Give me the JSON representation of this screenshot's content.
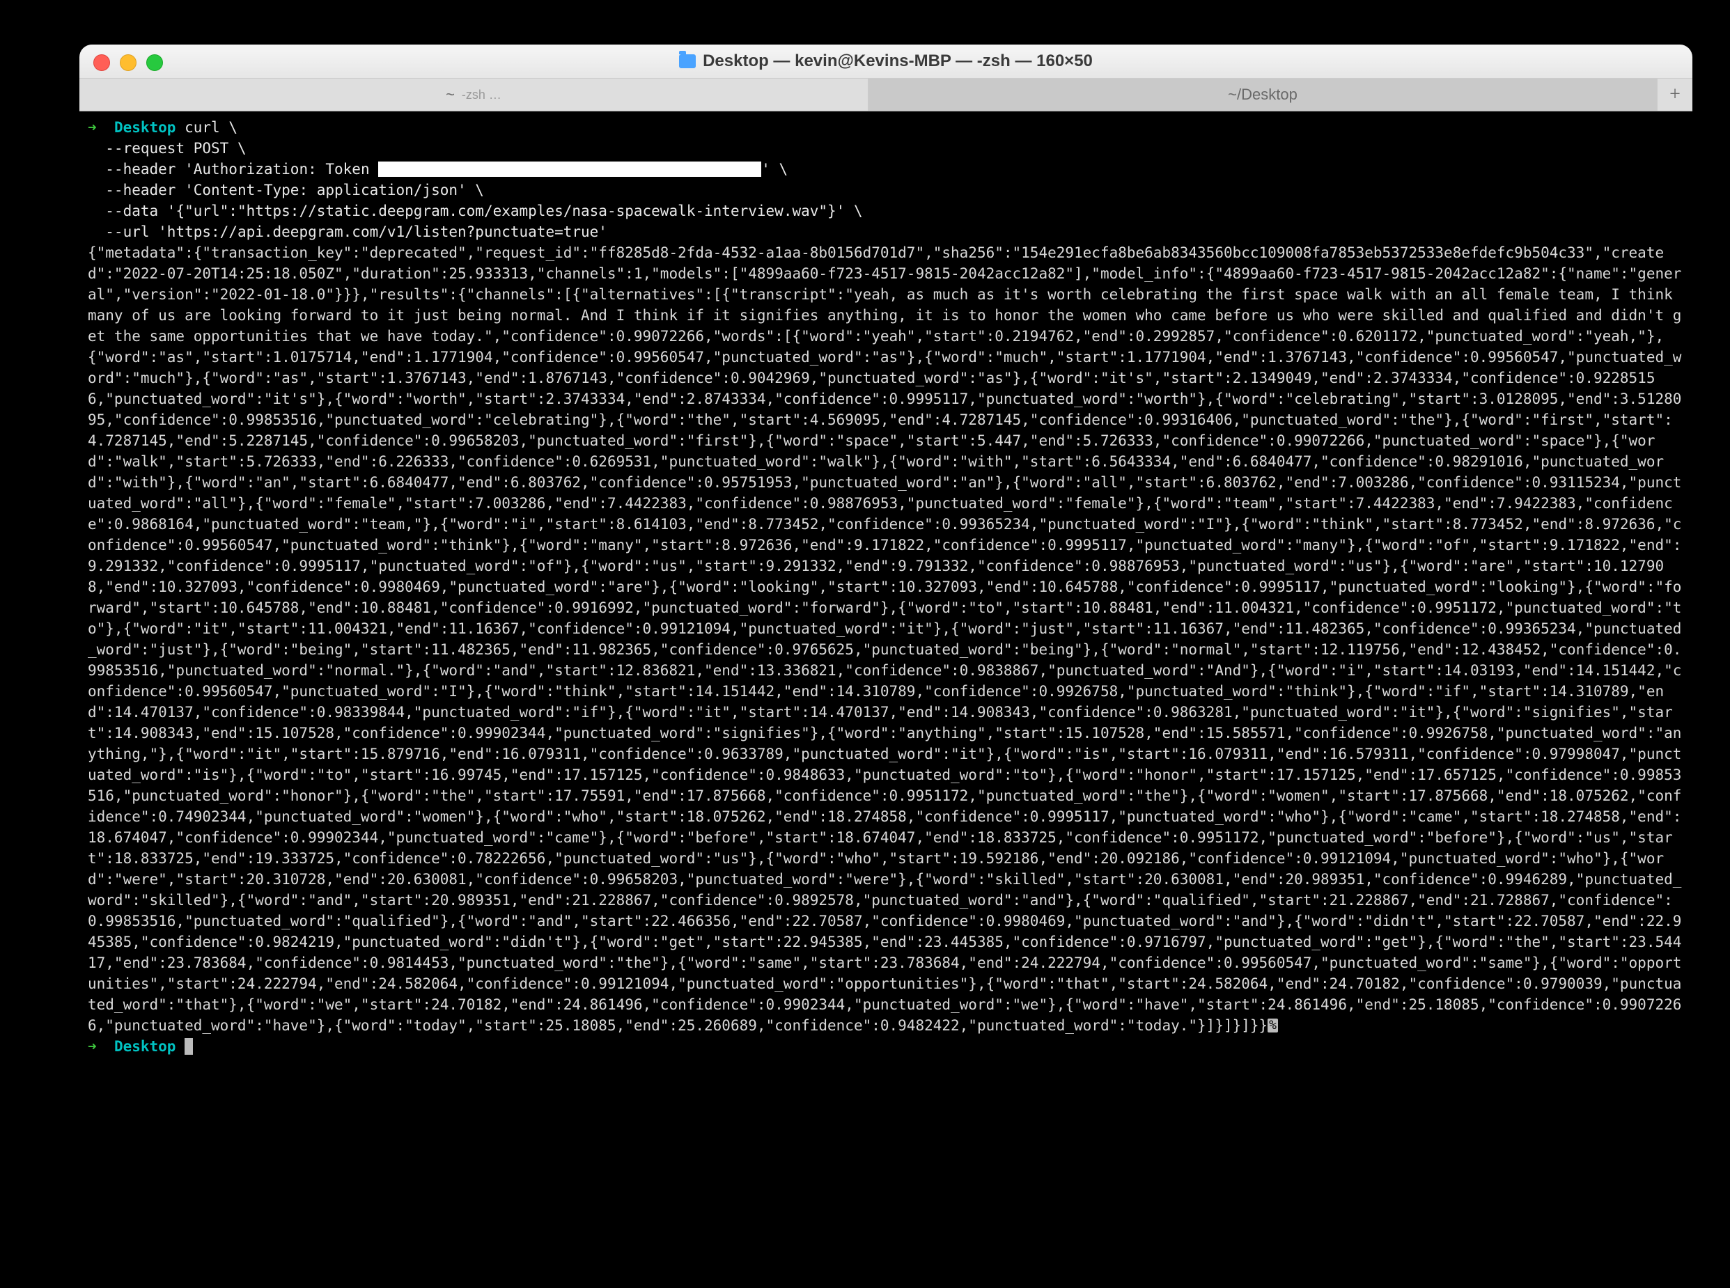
{
  "window": {
    "title": "Desktop — kevin@Kevins-MBP — -zsh — 160×50"
  },
  "tabs": {
    "left_main": "~",
    "left_sub": "-zsh …",
    "right": "~/Desktop",
    "newtab": "+"
  },
  "prompt": {
    "arrow": "➜",
    "dir": "Desktop"
  },
  "cmd": {
    "l1": "curl \\",
    "l2": "  --request POST \\",
    "l3a": "  --header 'Authorization: Token ",
    "l3b": "' \\",
    "l4": "  --header 'Content-Type: application/json' \\",
    "l5": "  --data '{\"url\":\"https://static.deepgram.com/examples/nasa-spacewalk-interview.wav\"}' \\",
    "l6": "  --url 'https://api.deepgram.com/v1/listen?punctuate=true'"
  },
  "output": "{\"metadata\":{\"transaction_key\":\"deprecated\",\"request_id\":\"ff8285d8-2fda-4532-a1aa-8b0156d701d7\",\"sha256\":\"154e291ecfa8be6ab8343560bcc109008fa7853eb5372533e8efdefc9b504c33\",\"created\":\"2022-07-20T14:25:18.050Z\",\"duration\":25.933313,\"channels\":1,\"models\":[\"4899aa60-f723-4517-9815-2042acc12a82\"],\"model_info\":{\"4899aa60-f723-4517-9815-2042acc12a82\":{\"name\":\"general\",\"version\":\"2022-01-18.0\"}}},\"results\":{\"channels\":[{\"alternatives\":[{\"transcript\":\"yeah, as much as it's worth celebrating the first space walk with an all female team, I think many of us are looking forward to it just being normal. And I think if it signifies anything, it is to honor the women who came before us who were skilled and qualified and didn't get the same opportunities that we have today.\",\"confidence\":0.99072266,\"words\":[{\"word\":\"yeah\",\"start\":0.2194762,\"end\":0.2992857,\"confidence\":0.6201172,\"punctuated_word\":\"yeah,\"},{\"word\":\"as\",\"start\":1.0175714,\"end\":1.1771904,\"confidence\":0.99560547,\"punctuated_word\":\"as\"},{\"word\":\"much\",\"start\":1.1771904,\"end\":1.3767143,\"confidence\":0.99560547,\"punctuated_word\":\"much\"},{\"word\":\"as\",\"start\":1.3767143,\"end\":1.8767143,\"confidence\":0.9042969,\"punctuated_word\":\"as\"},{\"word\":\"it's\",\"start\":2.1349049,\"end\":2.3743334,\"confidence\":0.92285156,\"punctuated_word\":\"it's\"},{\"word\":\"worth\",\"start\":2.3743334,\"end\":2.8743334,\"confidence\":0.9995117,\"punctuated_word\":\"worth\"},{\"word\":\"celebrating\",\"start\":3.0128095,\"end\":3.5128095,\"confidence\":0.99853516,\"punctuated_word\":\"celebrating\"},{\"word\":\"the\",\"start\":4.569095,\"end\":4.7287145,\"confidence\":0.99316406,\"punctuated_word\":\"the\"},{\"word\":\"first\",\"start\":4.7287145,\"end\":5.2287145,\"confidence\":0.99658203,\"punctuated_word\":\"first\"},{\"word\":\"space\",\"start\":5.447,\"end\":5.726333,\"confidence\":0.99072266,\"punctuated_word\":\"space\"},{\"word\":\"walk\",\"start\":5.726333,\"end\":6.226333,\"confidence\":0.6269531,\"punctuated_word\":\"walk\"},{\"word\":\"with\",\"start\":6.5643334,\"end\":6.6840477,\"confidence\":0.98291016,\"punctuated_word\":\"with\"},{\"word\":\"an\",\"start\":6.6840477,\"end\":6.803762,\"confidence\":0.95751953,\"punctuated_word\":\"an\"},{\"word\":\"all\",\"start\":6.803762,\"end\":7.003286,\"confidence\":0.93115234,\"punctuated_word\":\"all\"},{\"word\":\"female\",\"start\":7.003286,\"end\":7.4422383,\"confidence\":0.98876953,\"punctuated_word\":\"female\"},{\"word\":\"team\",\"start\":7.4422383,\"end\":7.9422383,\"confidence\":0.9868164,\"punctuated_word\":\"team,\"},{\"word\":\"i\",\"start\":8.614103,\"end\":8.773452,\"confidence\":0.99365234,\"punctuated_word\":\"I\"},{\"word\":\"think\",\"start\":8.773452,\"end\":8.972636,\"confidence\":0.99560547,\"punctuated_word\":\"think\"},{\"word\":\"many\",\"start\":8.972636,\"end\":9.171822,\"confidence\":0.9995117,\"punctuated_word\":\"many\"},{\"word\":\"of\",\"start\":9.171822,\"end\":9.291332,\"confidence\":0.9995117,\"punctuated_word\":\"of\"},{\"word\":\"us\",\"start\":9.291332,\"end\":9.791332,\"confidence\":0.98876953,\"punctuated_word\":\"us\"},{\"word\":\"are\",\"start\":10.127908,\"end\":10.327093,\"confidence\":0.9980469,\"punctuated_word\":\"are\"},{\"word\":\"looking\",\"start\":10.327093,\"end\":10.645788,\"confidence\":0.9995117,\"punctuated_word\":\"looking\"},{\"word\":\"forward\",\"start\":10.645788,\"end\":10.88481,\"confidence\":0.9916992,\"punctuated_word\":\"forward\"},{\"word\":\"to\",\"start\":10.88481,\"end\":11.004321,\"confidence\":0.9951172,\"punctuated_word\":\"to\"},{\"word\":\"it\",\"start\":11.004321,\"end\":11.16367,\"confidence\":0.99121094,\"punctuated_word\":\"it\"},{\"word\":\"just\",\"start\":11.16367,\"end\":11.482365,\"confidence\":0.99365234,\"punctuated_word\":\"just\"},{\"word\":\"being\",\"start\":11.482365,\"end\":11.982365,\"confidence\":0.9765625,\"punctuated_word\":\"being\"},{\"word\":\"normal\",\"start\":12.119756,\"end\":12.438452,\"confidence\":0.99853516,\"punctuated_word\":\"normal.\"},{\"word\":\"and\",\"start\":12.836821,\"end\":13.336821,\"confidence\":0.9838867,\"punctuated_word\":\"And\"},{\"word\":\"i\",\"start\":14.03193,\"end\":14.151442,\"confidence\":0.99560547,\"punctuated_word\":\"I\"},{\"word\":\"think\",\"start\":14.151442,\"end\":14.310789,\"confidence\":0.9926758,\"punctuated_word\":\"think\"},{\"word\":\"if\",\"start\":14.310789,\"end\":14.470137,\"confidence\":0.98339844,\"punctuated_word\":\"if\"},{\"word\":\"it\",\"start\":14.470137,\"end\":14.908343,\"confidence\":0.9863281,\"punctuated_word\":\"it\"},{\"word\":\"signifies\",\"start\":14.908343,\"end\":15.107528,\"confidence\":0.99902344,\"punctuated_word\":\"signifies\"},{\"word\":\"anything\",\"start\":15.107528,\"end\":15.585571,\"confidence\":0.9926758,\"punctuated_word\":\"anything,\"},{\"word\":\"it\",\"start\":15.879716,\"end\":16.079311,\"confidence\":0.9633789,\"punctuated_word\":\"it\"},{\"word\":\"is\",\"start\":16.079311,\"end\":16.579311,\"confidence\":0.97998047,\"punctuated_word\":\"is\"},{\"word\":\"to\",\"start\":16.99745,\"end\":17.157125,\"confidence\":0.9848633,\"punctuated_word\":\"to\"},{\"word\":\"honor\",\"start\":17.157125,\"end\":17.657125,\"confidence\":0.99853516,\"punctuated_word\":\"honor\"},{\"word\":\"the\",\"start\":17.75591,\"end\":17.875668,\"confidence\":0.9951172,\"punctuated_word\":\"the\"},{\"word\":\"women\",\"start\":17.875668,\"end\":18.075262,\"confidence\":0.74902344,\"punctuated_word\":\"women\"},{\"word\":\"who\",\"start\":18.075262,\"end\":18.274858,\"confidence\":0.9995117,\"punctuated_word\":\"who\"},{\"word\":\"came\",\"start\":18.274858,\"end\":18.674047,\"confidence\":0.99902344,\"punctuated_word\":\"came\"},{\"word\":\"before\",\"start\":18.674047,\"end\":18.833725,\"confidence\":0.9951172,\"punctuated_word\":\"before\"},{\"word\":\"us\",\"start\":18.833725,\"end\":19.333725,\"confidence\":0.78222656,\"punctuated_word\":\"us\"},{\"word\":\"who\",\"start\":19.592186,\"end\":20.092186,\"confidence\":0.99121094,\"punctuated_word\":\"who\"},{\"word\":\"were\",\"start\":20.310728,\"end\":20.630081,\"confidence\":0.99658203,\"punctuated_word\":\"were\"},{\"word\":\"skilled\",\"start\":20.630081,\"end\":20.989351,\"confidence\":0.9946289,\"punctuated_word\":\"skilled\"},{\"word\":\"and\",\"start\":20.989351,\"end\":21.228867,\"confidence\":0.9892578,\"punctuated_word\":\"and\"},{\"word\":\"qualified\",\"start\":21.228867,\"end\":21.728867,\"confidence\":0.99853516,\"punctuated_word\":\"qualified\"},{\"word\":\"and\",\"start\":22.466356,\"end\":22.70587,\"confidence\":0.9980469,\"punctuated_word\":\"and\"},{\"word\":\"didn't\",\"start\":22.70587,\"end\":22.945385,\"confidence\":0.9824219,\"punctuated_word\":\"didn't\"},{\"word\":\"get\",\"start\":22.945385,\"end\":23.445385,\"confidence\":0.9716797,\"punctuated_word\":\"get\"},{\"word\":\"the\",\"start\":23.54417,\"end\":23.783684,\"confidence\":0.9814453,\"punctuated_word\":\"the\"},{\"word\":\"same\",\"start\":23.783684,\"end\":24.222794,\"confidence\":0.99560547,\"punctuated_word\":\"same\"},{\"word\":\"opportunities\",\"start\":24.222794,\"end\":24.582064,\"confidence\":0.99121094,\"punctuated_word\":\"opportunities\"},{\"word\":\"that\",\"start\":24.582064,\"end\":24.70182,\"confidence\":0.9790039,\"punctuated_word\":\"that\"},{\"word\":\"we\",\"start\":24.70182,\"end\":24.861496,\"confidence\":0.9902344,\"punctuated_word\":\"we\"},{\"word\":\"have\",\"start\":24.861496,\"end\":25.18085,\"confidence\":0.99072266,\"punctuated_word\":\"have\"},{\"word\":\"today\",\"start\":25.18085,\"end\":25.260689,\"confidence\":0.9482422,\"punctuated_word\":\"today.\"}]}]}]}}",
  "percent_marker": "%"
}
